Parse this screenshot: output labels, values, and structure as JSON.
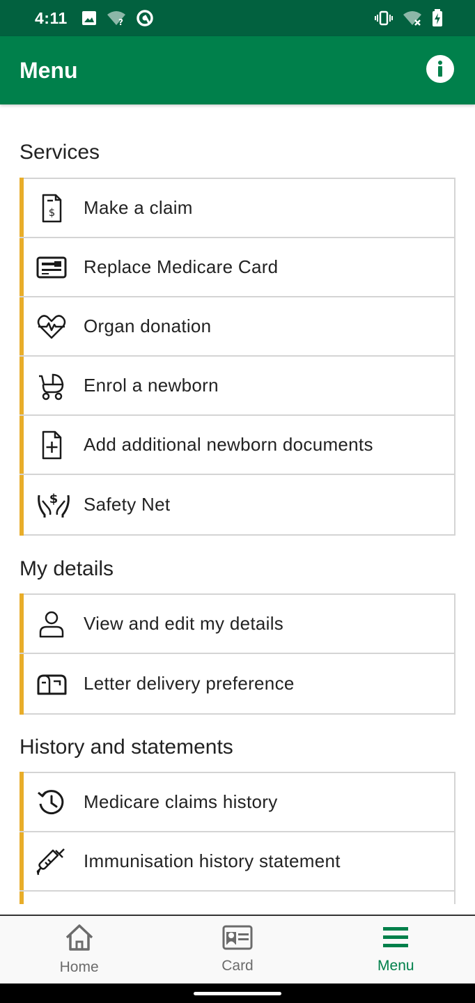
{
  "status_bar": {
    "time": "4:11",
    "left_icons": [
      "image-icon",
      "wifi-unknown-icon",
      "data-saver-icon"
    ],
    "right_icons": [
      "vibrate-icon",
      "wifi-off-icon",
      "battery-charging-icon"
    ]
  },
  "app_bar": {
    "title": "Menu",
    "info_icon": "info-icon"
  },
  "colors": {
    "status_bar": "#02613f",
    "app_bar": "#00804b",
    "accent_bar": "#e8ad2a",
    "active_nav": "#00804b"
  },
  "sections": [
    {
      "title": "Services",
      "items": [
        {
          "label": "Make a claim",
          "icon": "claim-receipt-icon"
        },
        {
          "label": "Replace Medicare Card",
          "icon": "medicare-card-icon"
        },
        {
          "label": "Organ donation",
          "icon": "heart-pulse-icon"
        },
        {
          "label": "Enrol a newborn",
          "icon": "pram-icon"
        },
        {
          "label": "Add additional newborn documents",
          "icon": "document-add-icon"
        },
        {
          "label": "Safety Net",
          "icon": "hands-dollar-icon"
        }
      ]
    },
    {
      "title": "My details",
      "items": [
        {
          "label": "View and edit my details",
          "icon": "person-icon"
        },
        {
          "label": "Letter delivery preference",
          "icon": "mailbox-icon"
        }
      ]
    },
    {
      "title": "History and statements",
      "items": [
        {
          "label": "Medicare claims history",
          "icon": "history-icon"
        },
        {
          "label": "Immunisation history statement",
          "icon": "syringe-icon"
        }
      ]
    }
  ],
  "bottom_nav": {
    "items": [
      {
        "label": "Home",
        "icon": "home-icon"
      },
      {
        "label": "Card",
        "icon": "id-card-icon"
      },
      {
        "label": "Menu",
        "icon": "menu-icon"
      }
    ],
    "active": "Menu"
  }
}
